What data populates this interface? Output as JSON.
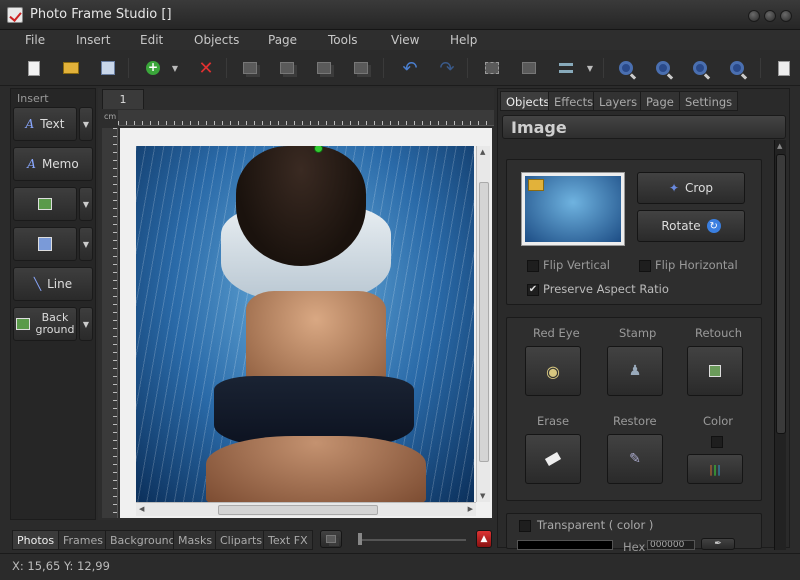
{
  "window": {
    "title": "Photo Frame Studio []"
  },
  "menu": [
    "File",
    "Insert",
    "Edit",
    "Objects",
    "Page",
    "Tools",
    "View",
    "Help"
  ],
  "toolbar": {
    "icons": [
      "new-file-icon",
      "open-folder-icon",
      "save-copy-icon",
      "add-green-icon",
      "delete-red-x-icon",
      "bring-front-icon",
      "bring-forward-icon",
      "send-backward-icon",
      "send-back-icon",
      "undo-icon",
      "redo-icon",
      "group-icon",
      "ungroup-icon",
      "align-icon",
      "zoom-in-icon",
      "zoom-out-icon",
      "zoom-fit-icon",
      "zoom-actual-icon",
      "print-preview-icon"
    ]
  },
  "insert": {
    "label": "Insert",
    "text_btn": "Text",
    "memo_btn": "Memo",
    "line_btn": "Line",
    "background_btn_line1": "Back",
    "background_btn_line2": "ground"
  },
  "canvas": {
    "page_tab": "1",
    "ruler_unit": "cm"
  },
  "bottom_tabs": [
    "Photos",
    "Frames",
    "Background",
    "Masks",
    "Cliparts",
    "Text FX"
  ],
  "right": {
    "tabs": [
      "Objects",
      "Effects",
      "Layers",
      "Page",
      "Settings"
    ],
    "header": "Image",
    "crop": "Crop",
    "rotate": "Rotate",
    "flip_vertical": "Flip Vertical",
    "flip_horizontal": "Flip Horizontal",
    "preserve_aspect": "Preserve Aspect Ratio",
    "red_eye": "Red Eye",
    "stamp": "Stamp",
    "retouch": "Retouch",
    "erase": "Erase",
    "restore": "Restore",
    "color": "Color",
    "transparent": "Transparent ( color )",
    "hex_label": "Hex",
    "hex_value": "000000"
  },
  "status": {
    "coords": "X: 15,65 Y: 12,99"
  },
  "colors": {
    "accent": "#4a6fb0",
    "handle": "#33cc33"
  }
}
